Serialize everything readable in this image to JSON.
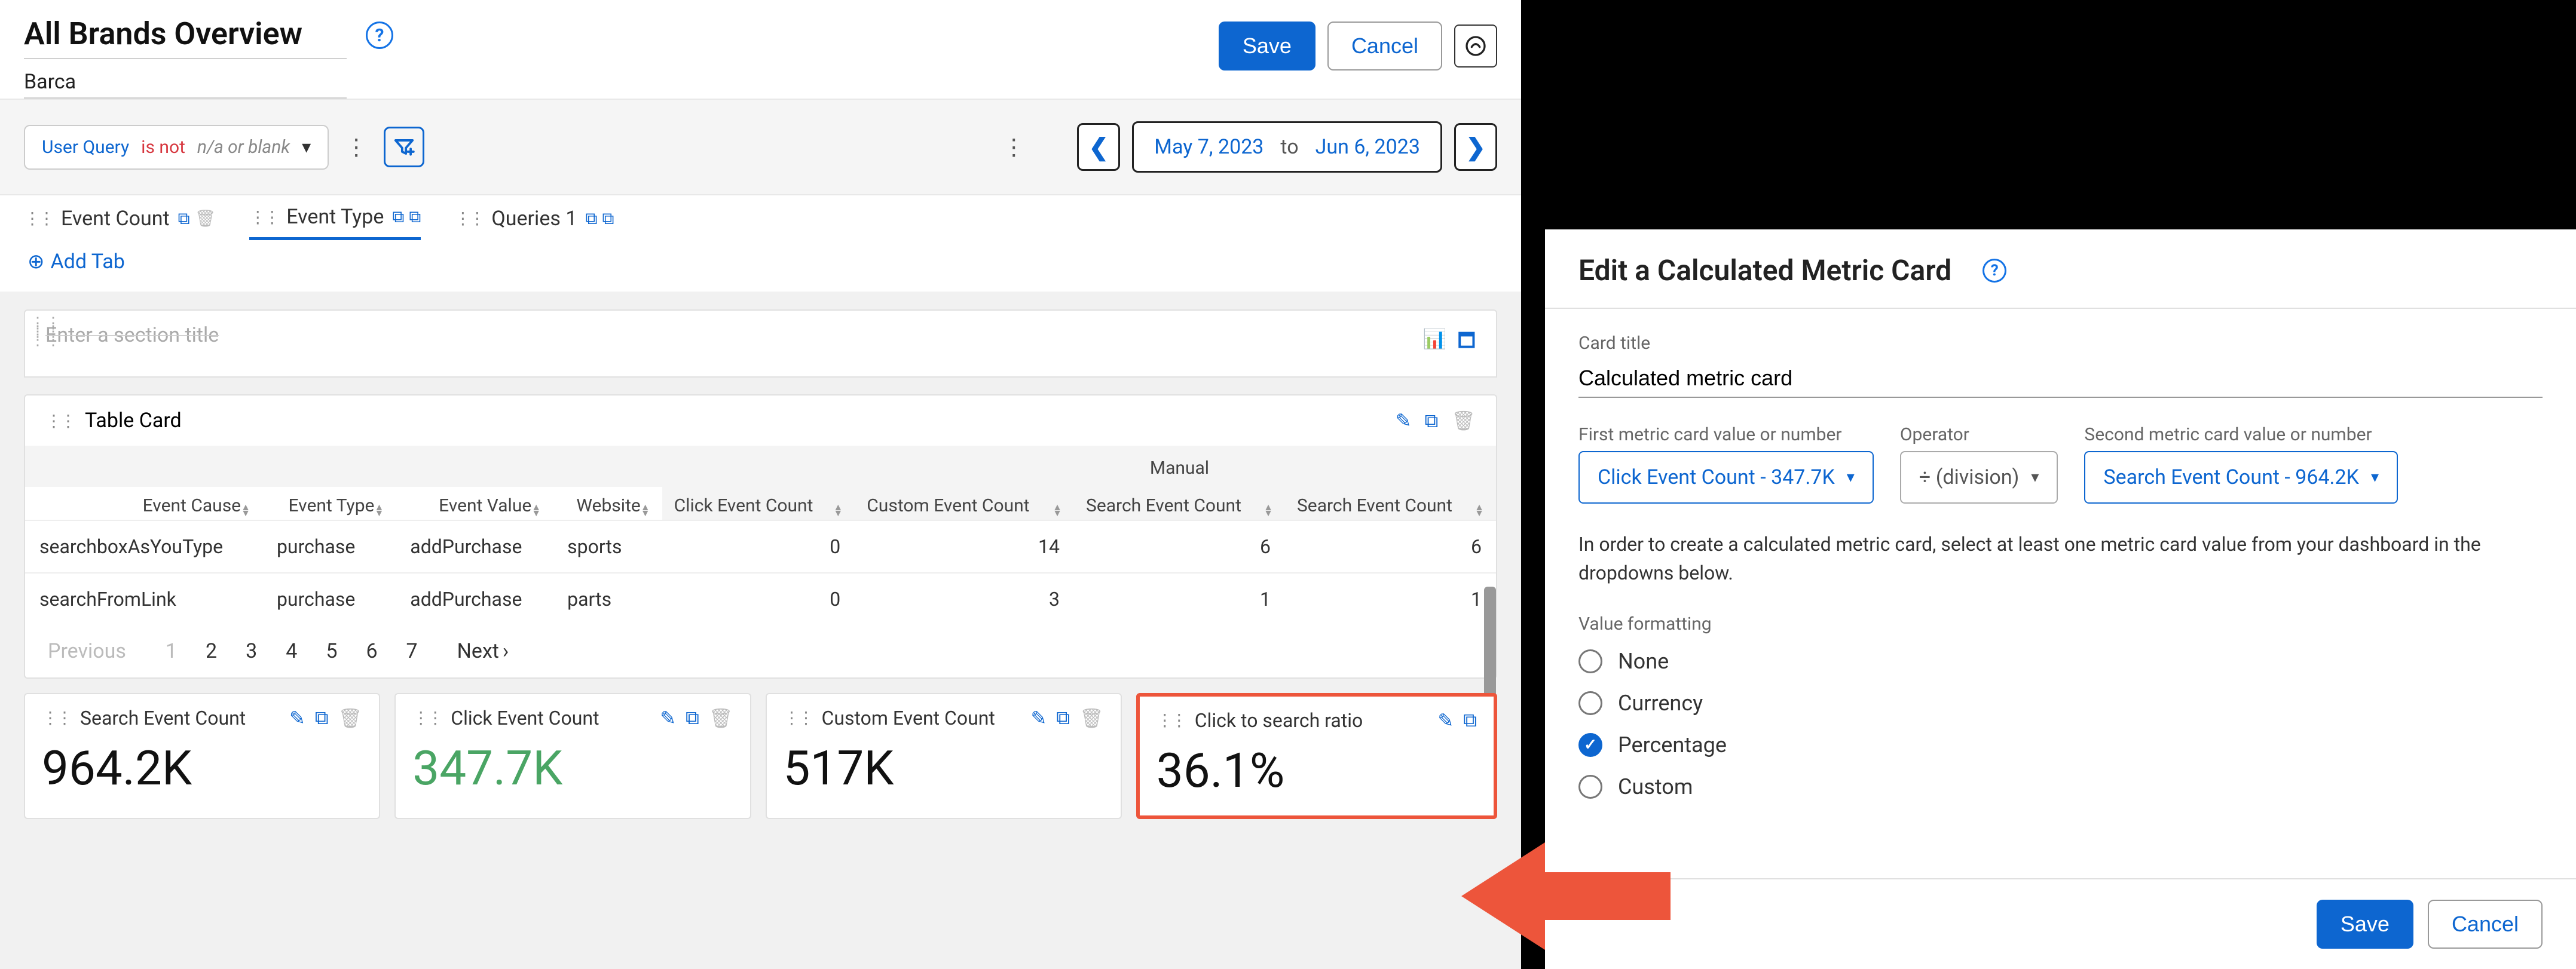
{
  "header": {
    "title": "All Brands Overview",
    "subtitle": "Barca",
    "save": "Save",
    "cancel": "Cancel"
  },
  "filter": {
    "field": "User Query",
    "op": "is not",
    "value": "n/a or blank",
    "date_from": "May 7, 2023",
    "date_to_label": "to",
    "date_to": "Jun 6, 2023"
  },
  "tabs": {
    "items": [
      {
        "label": "Event Count"
      },
      {
        "label": "Event Type"
      },
      {
        "label": "Queries 1"
      }
    ],
    "add": "Add Tab"
  },
  "section": {
    "placeholder": "Enter a section title"
  },
  "table": {
    "title": "Table Card",
    "cols_header2": "Manual",
    "cols": [
      "Event Cause",
      "Event Type",
      "Event Value",
      "Website",
      "Click Event Count",
      "Custom Event Count",
      "Search Event Count",
      "Search Event Count"
    ],
    "rows": [
      {
        "c": [
          "searchboxAsYouType",
          "purchase",
          "addPurchase",
          "sports",
          "0",
          "14",
          "6",
          "6"
        ]
      },
      {
        "c": [
          "searchFromLink",
          "purchase",
          "addPurchase",
          "parts",
          "0",
          "3",
          "1",
          "1"
        ]
      }
    ],
    "pagination": {
      "prev": "Previous",
      "pages": [
        "1",
        "2",
        "3",
        "4",
        "5",
        "6",
        "7"
      ],
      "next": "Next"
    }
  },
  "metrics": [
    {
      "title": "Search Event Count",
      "value": "964.2K"
    },
    {
      "title": "Click Event Count",
      "value": "347.7K",
      "green": true
    },
    {
      "title": "Custom Event Count",
      "value": "517K"
    },
    {
      "title": "Click to search ratio",
      "value": "36.1%",
      "highlight": true
    }
  ],
  "edit_panel": {
    "title": "Edit a Calculated Metric Card",
    "card_title_label": "Card title",
    "card_title_value": "Calculated metric card",
    "first_label": "First metric card value or number",
    "first_value": "Click Event Count - 347.7K",
    "op_label": "Operator",
    "op_value": "÷ (division)",
    "second_label": "Second metric card value or number",
    "second_value": "Search Event Count - 964.2K",
    "helper": "In order to create a calculated metric card, select at least one metric card value from your dashboard in the dropdowns below.",
    "format_label": "Value formatting",
    "formats": [
      "None",
      "Currency",
      "Percentage",
      "Custom"
    ],
    "format_selected": "Percentage",
    "save": "Save",
    "cancel": "Cancel"
  }
}
